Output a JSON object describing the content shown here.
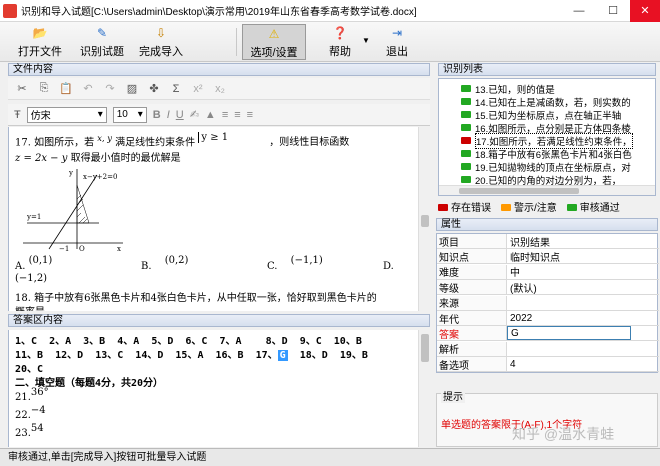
{
  "window": {
    "title": "识别和导入试题[C:\\Users\\admin\\Desktop\\演示常用\\2019年山东省春季高考数学试卷.docx]",
    "minimize": "—",
    "maximize": "☐",
    "close": "✕"
  },
  "toolbar": {
    "open_file": "打开文件",
    "recognize": "识别试题",
    "finish_import": "完成导入",
    "options": "选项/设置",
    "help": "帮助",
    "exit": "退出"
  },
  "file_panel": {
    "header": "文件内容",
    "font_name": "仿宋",
    "font_size": "10",
    "q17_line1a": "17. 如图所示，若",
    "q17_line1b": "x, y",
    "q17_line1c": "满足线性约束条件",
    "q17_constraint": "y ≥ 1",
    "q17_line1d": "，则线性目标函数",
    "q17_line2a": "z = 2x − y",
    "q17_line2b": "取得最小值时的最优解是",
    "graph_eq": "x−y+2=0",
    "graph_y1": "y=1",
    "graph_neg1": "−1",
    "graph_o": "O",
    "graph_x": "x",
    "graph_y": "y",
    "opt_a_label": "A.",
    "opt_a": "(0,1)",
    "opt_b_label": "B.",
    "opt_b": "(0,2)",
    "opt_c_label": "C.",
    "opt_c": "(−1,1)",
    "opt_d_label": "D.",
    "opt_d": "(−1,2)",
    "q18_text": "18. 箱子中放有6张黑色卡片和4张白色卡片，从中任取一张，恰好取到黑色卡片的",
    "q18_more": "概率是"
  },
  "answer_panel": {
    "header": "答案区内容",
    "line1": "1、C  2、A  3、B  4、A  5、D  6、C  7、A    8、D  9、C  10、B",
    "line2_pre": "11、B  12、D  13、C  14、D  15、A  16、B  17、",
    "line2_hl": "G",
    "line2_post": "  18、D  19、B",
    "line3": "20、C",
    "line4": "二、填空题（每题4分，共20分）",
    "a21_label": "21.",
    "a21_val": "36°",
    "a22_label": "22.",
    "a22_val": "−4",
    "a23_label": "23.",
    "a23_val": "54"
  },
  "list_panel": {
    "header": "识别列表",
    "items": [
      {
        "text": "13.已知，则的值是",
        "status": "ok"
      },
      {
        "text": "14.已知在上是减函数，若，则实数的",
        "status": "ok"
      },
      {
        "text": "15.已知为坐标原点，点在轴正半轴",
        "status": "ok"
      },
      {
        "text": "16.如图所示，点分别是正方体四条棱",
        "status": "ok"
      },
      {
        "text": "17.如图所示，若满足线性约束条件，",
        "status": "error"
      },
      {
        "text": "18.箱子中放有6张黑色卡片和4张白色",
        "status": "ok"
      },
      {
        "text": "19.已知拋物线的顶点在坐标原点，对",
        "status": "ok"
      },
      {
        "text": "20.已知的内角的对边分别为，若，",
        "status": "ok"
      }
    ],
    "legend_error": "存在错误",
    "legend_warn": "警示/注意",
    "legend_ok": "审核通过",
    "colors": {
      "ok": "#22a822",
      "error": "#cc0000",
      "warn": "#ff9900"
    }
  },
  "props_panel": {
    "header": "属性",
    "rows": [
      {
        "k": "项目",
        "v": "识别结果"
      },
      {
        "k": "知识点",
        "v": "临时知识点"
      },
      {
        "k": "难度",
        "v": "中"
      },
      {
        "k": "等级",
        "v": "(默认)"
      },
      {
        "k": "来源",
        "v": ""
      },
      {
        "k": "年代",
        "v": "2022"
      },
      {
        "k": "答案",
        "v": "G"
      },
      {
        "k": "解析",
        "v": ""
      },
      {
        "k": "备选项",
        "v": "4"
      }
    ]
  },
  "hint_panel": {
    "title": "提示",
    "message": "单选题的答案限于(A-F),1个字符"
  },
  "watermark": "知乎 @温水青蛙",
  "status": "审核通过,单击[完成导入]按钮可批量导入试题"
}
